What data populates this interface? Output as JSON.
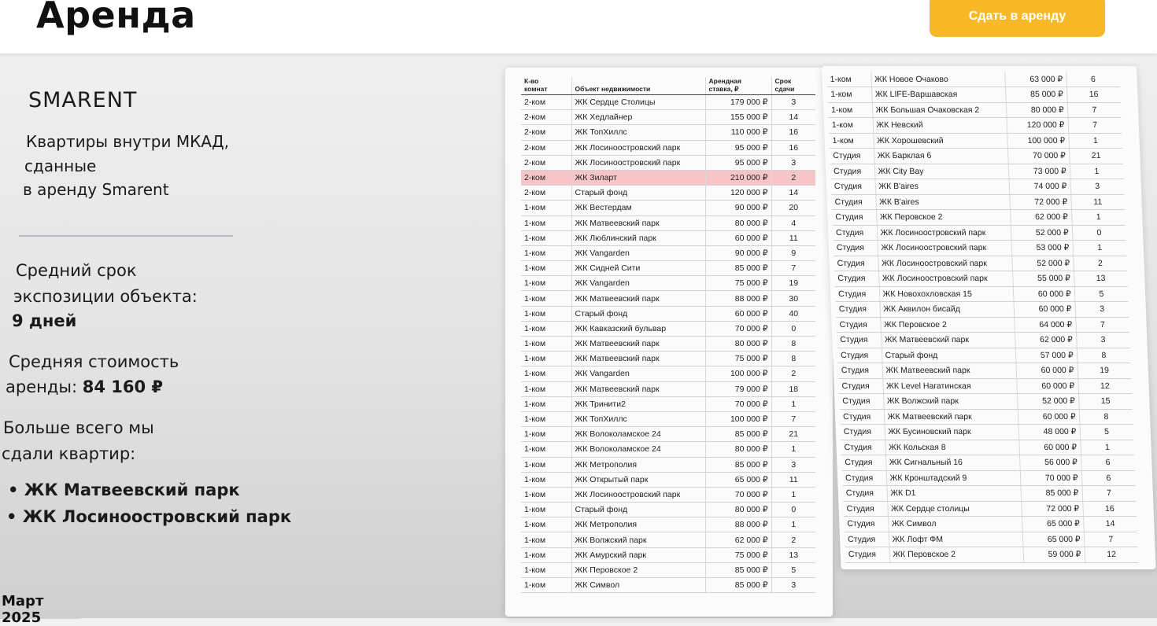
{
  "header": {
    "title": "Аренда",
    "rent_button": "Сдать в аренду"
  },
  "brand": "SMARENT",
  "description": [
    "Квартиры внутри МКАД,",
    "сданные",
    "в аренду Smarent"
  ],
  "stats": {
    "exposure_label_1": "Средний срок",
    "exposure_label_2": "экспозиции объекта:",
    "exposure_value": "9 дней",
    "cost_label_1": "Средняя стоимость",
    "cost_label_2": "аренды:",
    "cost_value": "84 160 ₽",
    "most_label_1": "Больше всего мы",
    "most_label_2": "сдали квартир:"
  },
  "top_complexes": [
    "ЖК Матвеевский парк",
    "ЖК Лосиноостровский парк"
  ],
  "date": "Март 2025",
  "table_headers": {
    "rooms": [
      "К-во",
      "комнат"
    ],
    "object": "Объект недвижимости",
    "rate": [
      "Арендная",
      "ставка, ₽"
    ],
    "term": [
      "Срок",
      "сдачи"
    ]
  },
  "table1_highlight_index": 5,
  "table1": [
    [
      "2-ком",
      "ЖК Сердце Столицы",
      "179 000 ₽",
      "3"
    ],
    [
      "2-ком",
      "ЖК Хедлайнер",
      "155 000 ₽",
      "14"
    ],
    [
      "2-ком",
      "ЖК ТопХиллс",
      "110 000 ₽",
      "16"
    ],
    [
      "2-ком",
      "ЖК Лосиноостровский парк",
      "95 000 ₽",
      "16"
    ],
    [
      "2-ком",
      "ЖК Лосиноостровский парк",
      "95 000 ₽",
      "3"
    ],
    [
      "2-ком",
      "ЖК Зиларт",
      "210 000 ₽",
      "2"
    ],
    [
      "2-ком",
      "Старый фонд",
      "120 000 ₽",
      "14"
    ],
    [
      "1-ком",
      "ЖК Вестердам",
      "90 000 ₽",
      "20"
    ],
    [
      "1-ком",
      "ЖК Матвеевский парк",
      "80 000 ₽",
      "4"
    ],
    [
      "1-ком",
      "ЖК Люблинский парк",
      "60 000 ₽",
      "11"
    ],
    [
      "1-ком",
      "ЖК Vangarden",
      "90 000 ₽",
      "9"
    ],
    [
      "1-ком",
      "ЖК Сидней Сити",
      "85 000 ₽",
      "7"
    ],
    [
      "1-ком",
      "ЖК Vangarden",
      "75 000 ₽",
      "19"
    ],
    [
      "1-ком",
      "ЖК Матвеевский парк",
      "88 000 ₽",
      "30"
    ],
    [
      "1-ком",
      "Старый фонд",
      "60 000 ₽",
      "40"
    ],
    [
      "1-ком",
      "ЖК Кавказский бульвар",
      "70 000 ₽",
      "0"
    ],
    [
      "1-ком",
      "ЖК Матвеевский парк",
      "80 000 ₽",
      "8"
    ],
    [
      "1-ком",
      "ЖК Матвеевский парк",
      "75 000 ₽",
      "8"
    ],
    [
      "1-ком",
      "ЖК Vangarden",
      "100 000 ₽",
      "2"
    ],
    [
      "1-ком",
      "ЖК Матвеевский парк",
      "79 000 ₽",
      "18"
    ],
    [
      "1-ком",
      "ЖК Тринити2",
      "70 000 ₽",
      "1"
    ],
    [
      "1-ком",
      "ЖК ТопХиллс",
      "100 000 ₽",
      "7"
    ],
    [
      "1-ком",
      "ЖК Волоколамское 24",
      "85 000 ₽",
      "21"
    ],
    [
      "1-ком",
      "ЖК Волоколамское 24",
      "80 000 ₽",
      "1"
    ],
    [
      "1-ком",
      "ЖК Метрополия",
      "85 000 ₽",
      "3"
    ],
    [
      "1-ком",
      "ЖК Открытый парк",
      "65 000 ₽",
      "11"
    ],
    [
      "1-ком",
      "ЖК Лосиноостровский парк",
      "70 000 ₽",
      "1"
    ],
    [
      "1-ком",
      "Старый фонд",
      "80 000 ₽",
      "0"
    ],
    [
      "1-ком",
      "ЖК Метрополия",
      "88 000 ₽",
      "1"
    ],
    [
      "1-ком",
      "ЖК Волжский парк",
      "62 000 ₽",
      "2"
    ],
    [
      "1-ком",
      "ЖК Амурский парк",
      "75 000 ₽",
      "13"
    ],
    [
      "1-ком",
      "ЖК Перовское 2",
      "85 000 ₽",
      "5"
    ],
    [
      "1-ком",
      "ЖК Символ",
      "85 000 ₽",
      "3"
    ]
  ],
  "table2": [
    [
      "1-ком",
      "ЖК Новое Очаково",
      "63 000 ₽",
      "6"
    ],
    [
      "1-ком",
      "ЖК LIFE-Варшавская",
      "85 000 ₽",
      "16"
    ],
    [
      "1-ком",
      "ЖК Большая Очаковская 2",
      "80 000 ₽",
      "7"
    ],
    [
      "1-ком",
      "ЖК Невский",
      "120 000 ₽",
      "7"
    ],
    [
      "1-ком",
      "ЖК Хорошевский",
      "100 000 ₽",
      "1"
    ],
    [
      "Студия",
      "ЖК Барклая 6",
      "70 000 ₽",
      "21"
    ],
    [
      "Студия",
      "ЖК City Bay",
      "73 000 ₽",
      "1"
    ],
    [
      "Студия",
      "ЖК B'aires",
      "74 000 ₽",
      "3"
    ],
    [
      "Студия",
      "ЖК B'aires",
      "72 000 ₽",
      "11"
    ],
    [
      "Студия",
      "ЖК Перовское 2",
      "62 000 ₽",
      "1"
    ],
    [
      "Студия",
      "ЖК Лосиноостровский парк",
      "52 000 ₽",
      "0"
    ],
    [
      "Студия",
      "ЖК Лосиноостровский парк",
      "53 000 ₽",
      "1"
    ],
    [
      "Студия",
      "ЖК Лосиноостровский парк",
      "52 000 ₽",
      "2"
    ],
    [
      "Студия",
      "ЖК Лосиноостровский парк",
      "55 000 ₽",
      "13"
    ],
    [
      "Студия",
      "ЖК Новохохловская 15",
      "60 000 ₽",
      "5"
    ],
    [
      "Студия",
      "ЖК Аквилон бисайд",
      "60 000 ₽",
      "3"
    ],
    [
      "Студия",
      "ЖК Перовское 2",
      "64 000 ₽",
      "7"
    ],
    [
      "Студия",
      "ЖК Матвеевский парк",
      "62 000 ₽",
      "3"
    ],
    [
      "Студия",
      "Старый фонд",
      "57 000 ₽",
      "8"
    ],
    [
      "Студия",
      "ЖК Матвеевский парк",
      "60 000 ₽",
      "19"
    ],
    [
      "Студия",
      "ЖК Level Нагатинская",
      "60 000 ₽",
      "12"
    ],
    [
      "Студия",
      "ЖК Волжский парк",
      "52 000 ₽",
      "15"
    ],
    [
      "Студия",
      "ЖК Матвеевский парк",
      "60 000 ₽",
      "8"
    ],
    [
      "Студия",
      "ЖК Бусиновский парк",
      "48 000 ₽",
      "5"
    ],
    [
      "Студия",
      "ЖК Кольская 8",
      "60 000 ₽",
      "1"
    ],
    [
      "Студия",
      "ЖК Сигнальный 16",
      "56 000 ₽",
      "6"
    ],
    [
      "Студия",
      "ЖК Кронштадский 9",
      "70 000 ₽",
      "6"
    ],
    [
      "Студия",
      "ЖК D1",
      "85 000 ₽",
      "7"
    ],
    [
      "Студия",
      "ЖК Сердце столицы",
      "72 000 ₽",
      "16"
    ],
    [
      "Студия",
      "ЖК Символ",
      "65 000 ₽",
      "14"
    ],
    [
      "Студия",
      "ЖК Лофт ФМ",
      "65 000 ₽",
      "7"
    ],
    [
      "Студия",
      "ЖК Перовское 2",
      "59 000 ₽",
      "12"
    ]
  ]
}
